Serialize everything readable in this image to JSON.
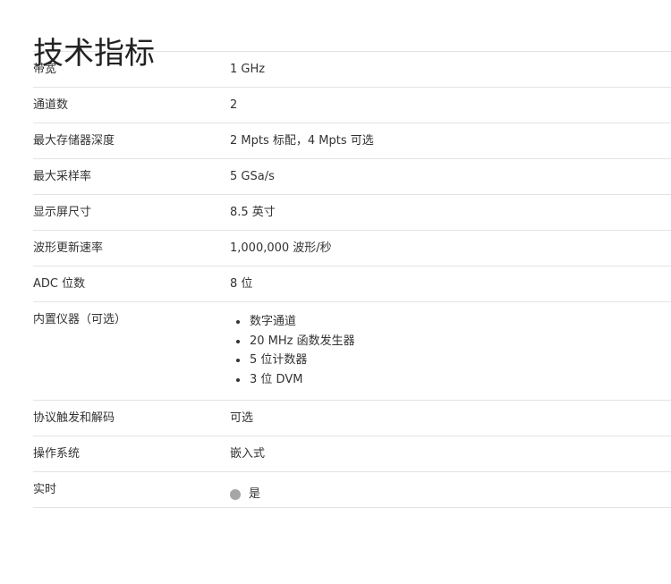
{
  "title": "技术指标",
  "specs": [
    {
      "label": "带宽",
      "value": "1 GHz"
    },
    {
      "label": "通道数",
      "value": "2"
    },
    {
      "label": "最大存储器深度",
      "value": "2 Mpts 标配，4 Mpts 可选"
    },
    {
      "label": "最大采样率",
      "value": "5 GSa/s"
    },
    {
      "label": "显示屏尺寸",
      "value": "8.5 英寸"
    },
    {
      "label": "波形更新速率",
      "value": "1,000,000 波形/秒"
    },
    {
      "label": "ADC 位数",
      "value": "8 位"
    },
    {
      "label": "内置仪器（可选）",
      "items": [
        "数字通道",
        "20 MHz 函数发生器",
        "5 位计数器",
        "3 位 DVM"
      ]
    },
    {
      "label": "协议触发和解码",
      "value": "可选"
    },
    {
      "label": "操作系统",
      "value": "嵌入式"
    },
    {
      "label": "实时",
      "value": "是"
    }
  ],
  "colors": {
    "status_dot": "#a6a6a6",
    "divider": "#e3e3e3",
    "text": "#333333"
  },
  "icons": {
    "realtime_indicator": "status-dot-icon"
  }
}
